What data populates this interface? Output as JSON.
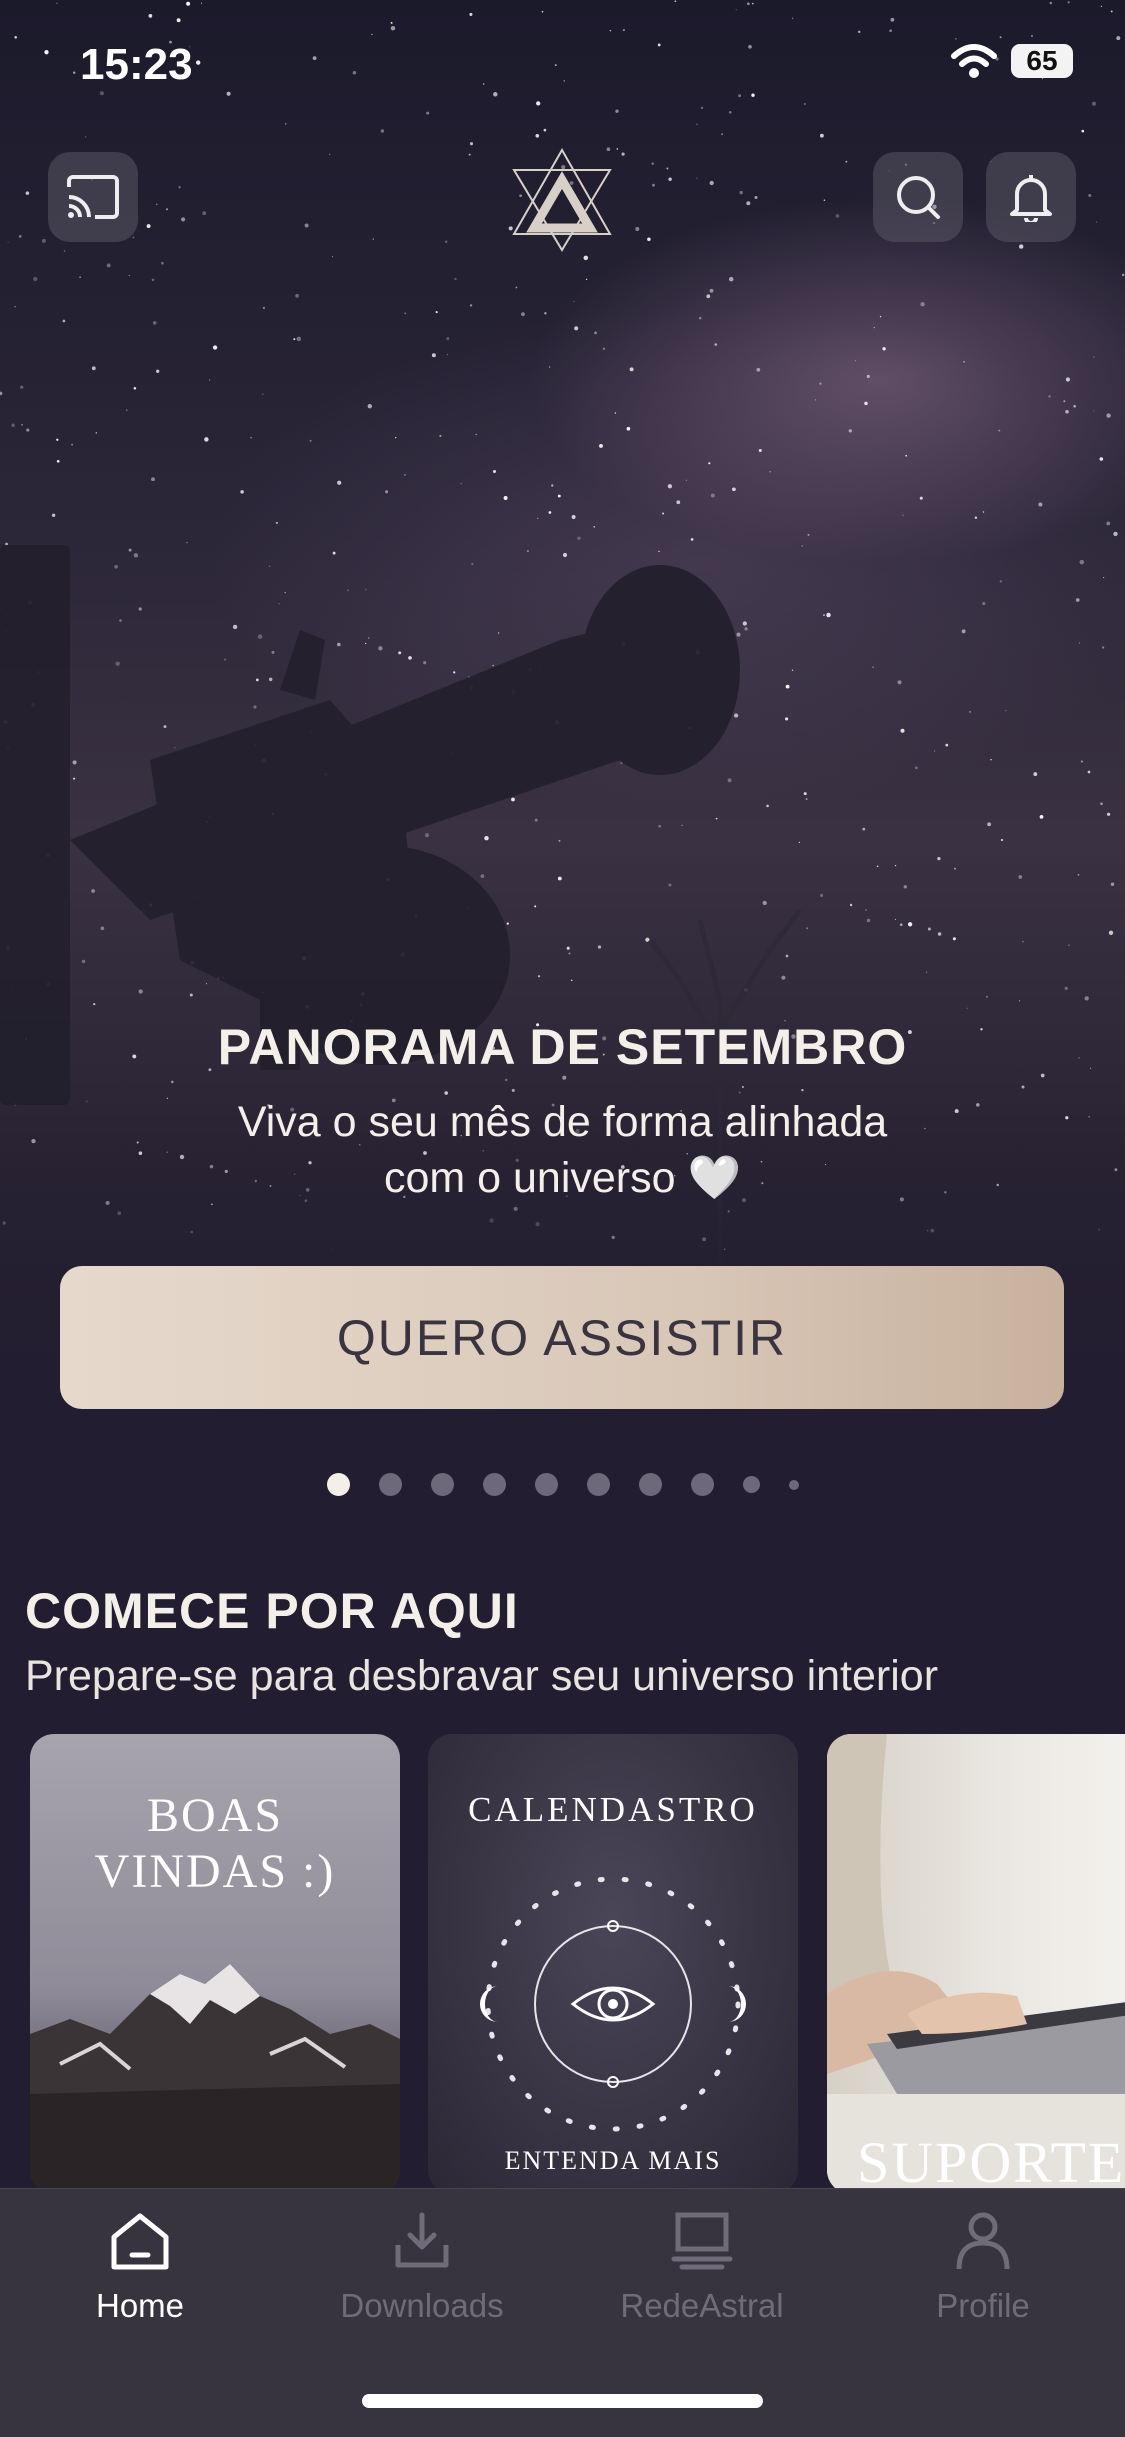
{
  "status_bar": {
    "time": "15:23",
    "battery": "65"
  },
  "hero": {
    "title": "PANORAMA DE SETEMBRO",
    "subtitle_line1": "Viva o seu mês de forma alinhada",
    "subtitle_line2": "com o universo 🤍",
    "cta_label": "QUERO ASSISTIR",
    "carousel": {
      "total": 10,
      "active_index": 1
    }
  },
  "section": {
    "title": "COMECE POR AQUI",
    "subtitle": "Prepare-se para desbravar seu universo interior",
    "cards": [
      {
        "title_line1": "BOAS",
        "title_line2": "VINDAS :)"
      },
      {
        "title": "CALENDASTRO",
        "footer": "ENTENDA MAIS"
      },
      {
        "title": "SUPORTE"
      }
    ]
  },
  "tabbar": {
    "items": [
      {
        "label": "Home",
        "icon": "home-icon",
        "active": true
      },
      {
        "label": "Downloads",
        "icon": "download-icon",
        "active": false
      },
      {
        "label": "RedeAstral",
        "icon": "laptop-icon",
        "active": false
      },
      {
        "label": "Profile",
        "icon": "person-icon",
        "active": false
      }
    ]
  },
  "colors": {
    "background": "#221d30",
    "cta_start": "#e6d9cc",
    "cta_end": "#c8b19e",
    "tab_inactive": "#6f6b78"
  }
}
